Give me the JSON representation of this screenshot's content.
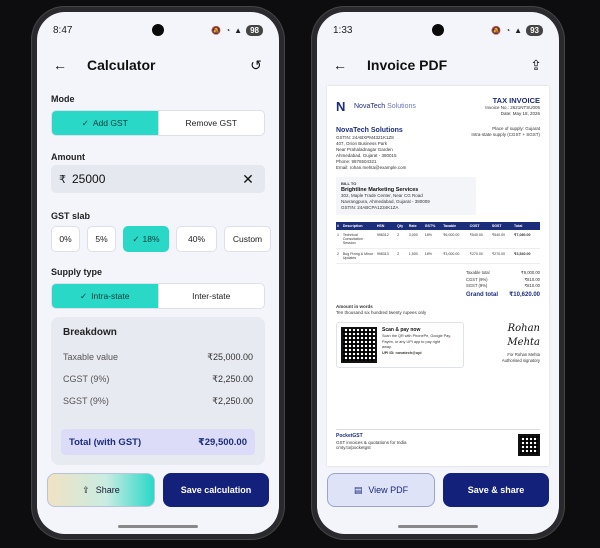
{
  "calc": {
    "time": "8:47",
    "battery": "98",
    "title": "Calculator",
    "mode_label": "Mode",
    "mode_options": [
      "Add GST",
      "Remove GST"
    ],
    "amount_label": "Amount",
    "currency": "₹",
    "amount_value": "25000",
    "slab_label": "GST slab",
    "slabs": [
      "0%",
      "5%",
      "18%",
      "40%",
      "Custom"
    ],
    "supply_label": "Supply type",
    "supply_options": [
      "Intra-state",
      "Inter-state"
    ],
    "breakdown_title": "Breakdown",
    "rows": [
      {
        "label": "Taxable value",
        "value": "₹25,000.00"
      },
      {
        "label": "CGST (9%)",
        "value": "₹2,250.00"
      },
      {
        "label": "SGST (9%)",
        "value": "₹2,250.00"
      }
    ],
    "total_label": "Total (with GST)",
    "total_value": "₹29,500.00",
    "share_label": "Share",
    "save_label": "Save calculation"
  },
  "invoice": {
    "time": "1:33",
    "battery": "93",
    "title": "Invoice PDF",
    "brand": "NovaTech",
    "brand_suffix": "Solutions",
    "doc_title": "TAX INVOICE",
    "invoice_no": "Invoice No.: 2621NTSU005",
    "date": "Date: May 18, 2026",
    "company_name": "NovaTech Solutions",
    "company_lines": [
      "GSTIN: 24ABXPM4321K1Z8",
      "407, Orion Business Park",
      "Near Prahaladnagar Garden",
      "Ahmedabad, Gujarat - 380015",
      "Phone: 9876504321",
      "Email: rohan.mehta@example.com"
    ],
    "place_lines": [
      "Place of supply: Gujarat",
      "Intra-state supply (CGST + SGST)"
    ],
    "bill_to_label": "BILL TO",
    "bill_to_name": "Brightline Marketing Services",
    "bill_to_lines": [
      "302, Maple Trade Center, Near CG Road",
      "Navrangpura, Ahmedabad, Gujarat - 380009",
      "GSTIN: 24ABCPA1234K1ZA"
    ],
    "table_headers": [
      "#",
      "Description",
      "HSN",
      "Qty",
      "Rate",
      "GST%",
      "Taxable",
      "CGST",
      "SGST",
      "Total"
    ],
    "table_rows": [
      [
        "1",
        "Technical Consultation Session",
        "998312",
        "2",
        "3,000",
        "18%",
        "₹6,000.00",
        "₹540.00",
        "₹540.00",
        "₹7,080.00"
      ],
      [
        "2",
        "Bug Fixing & Minor Updates",
        "998313",
        "2",
        "1,500",
        "18%",
        "₹3,000.00",
        "₹270.00",
        "₹270.00",
        "₹3,540.00"
      ]
    ],
    "totals": [
      {
        "label": "Taxable total",
        "value": "₹9,000.00"
      },
      {
        "label": "CGST (9%)",
        "value": "₹810.00"
      },
      {
        "label": "SGST (9%)",
        "value": "₹810.00"
      }
    ],
    "grand_label": "Grand total",
    "grand_value": "₹10,620.00",
    "words_label": "Amount in words",
    "words_value": "Ten thousand six hundred twenty rupees only",
    "pay_title": "Scan & pay now",
    "pay_lines": [
      "Scan the QR with PhonePe, Google Pay,",
      "Paytm, or any UPI app to pay right",
      "away."
    ],
    "upi": "UPI ID: novatech@upi",
    "signature": "Rohan Mehta",
    "sign_lines": [
      "For Rohan Mehta",
      "Authorised signatory"
    ],
    "footer_brand": "PocketGST",
    "footer_lines": [
      "GST invoices & quotations for India",
      "cmty.to/pocketgst"
    ],
    "view_label": "View PDF",
    "save_share_label": "Save & share"
  }
}
